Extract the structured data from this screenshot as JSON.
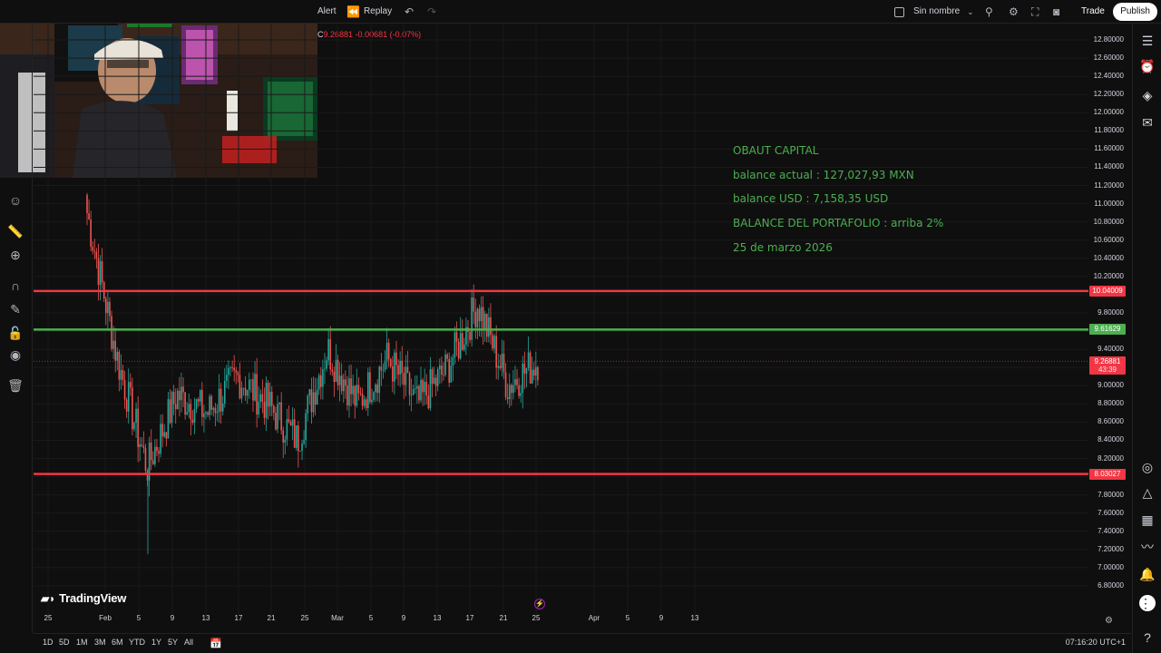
{
  "topbar": {
    "alert_label": "Alert",
    "replay_label": "Replay",
    "layout_name": "Sin nombre",
    "trade_label": "Trade",
    "publish_label": "Publish"
  },
  "ohlc": {
    "close_letter": "C",
    "close_value": "9.26881",
    "change": "-0.00681 (-0.07%)"
  },
  "info": {
    "line1": "OBAUT CAPITAL",
    "line2": "balance actual : 127,027,93 MXN",
    "line3": "balance USD : 7,158,35 USD",
    "line4": "BALANCE DEL PORTAFOLIO :  arriba 2%",
    "line5": "25 de marzo 2026"
  },
  "price_axis": {
    "labels": [
      "12.80000",
      "12.60000",
      "12.40000",
      "12.20000",
      "12.00000",
      "11.80000",
      "11.60000",
      "11.40000",
      "11.20000",
      "11.00000",
      "10.80000",
      "10.60000",
      "10.40000",
      "10.20000",
      "10.00000",
      "9.80000",
      "9.60000",
      "9.40000",
      "9.20000",
      "9.00000",
      "8.80000",
      "8.60000",
      "8.40000",
      "8.20000",
      "8.00000",
      "7.80000",
      "7.60000",
      "7.40000",
      "7.20000",
      "7.00000",
      "6.80000"
    ],
    "tags": {
      "red_top": "10.04009",
      "green": "9.61629",
      "current_price": "9.26881",
      "countdown": "43:39",
      "red_bottom": "8.03027"
    }
  },
  "time_axis": {
    "labels": [
      "25",
      "Feb",
      "5",
      "9",
      "13",
      "17",
      "21",
      "25",
      "Mar",
      "5",
      "9",
      "13",
      "17",
      "21",
      "25",
      "Apr",
      "5",
      "9",
      "13"
    ]
  },
  "brand": {
    "logo_text": "TradingView"
  },
  "bottom": {
    "ranges": [
      "1D",
      "5D",
      "1M",
      "3M",
      "6M",
      "YTD",
      "1Y",
      "5Y",
      "All"
    ],
    "clock": "07:16:20 UTC+1"
  },
  "colors": {
    "resistance": "#f23645",
    "support_green": "#4caf50",
    "candle_up": "#26a69a",
    "candle_down": "#ef5350",
    "info_text": "#4caf50"
  },
  "chart_data": {
    "type": "candlestick",
    "horizontal_lines": [
      10.04009,
      9.61629,
      8.03027
    ],
    "current_price": 9.26881,
    "ylim": [
      6.7,
      12.9
    ],
    "x": [
      "25",
      "Feb",
      "5",
      "9",
      "13",
      "17",
      "21",
      "25",
      "Mar",
      "5",
      "9",
      "13",
      "17",
      "21",
      "25"
    ],
    "close": [
      10.9,
      9.3,
      8.1,
      8.9,
      8.7,
      9.1,
      8.8,
      8.4,
      9.4,
      8.8,
      9.3,
      8.8,
      9.2,
      9.9,
      9.0,
      9.27
    ]
  }
}
